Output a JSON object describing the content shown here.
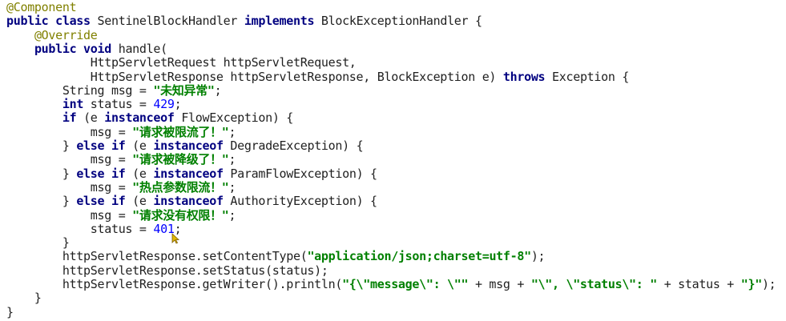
{
  "editor": {
    "colors": {
      "keyword": "#000080",
      "annotation": "#808000",
      "string": "#008000",
      "number": "#0000ff",
      "text": "#1f1f1f",
      "background": "#ffffff"
    },
    "lines": [
      [
        {
          "t": "ann",
          "v": "@Component"
        }
      ],
      [
        {
          "t": "kw",
          "v": "public class "
        },
        {
          "t": "p",
          "v": "SentinelBlockHandler "
        },
        {
          "t": "kw",
          "v": "implements "
        },
        {
          "t": "p",
          "v": "BlockExceptionHandler {"
        }
      ],
      [
        {
          "t": "p",
          "v": "    "
        },
        {
          "t": "ann",
          "v": "@Override"
        }
      ],
      [
        {
          "t": "p",
          "v": "    "
        },
        {
          "t": "kw",
          "v": "public void "
        },
        {
          "t": "p",
          "v": "handle("
        }
      ],
      [
        {
          "t": "p",
          "v": "            HttpServletRequest httpServletRequest,"
        }
      ],
      [
        {
          "t": "p",
          "v": "            HttpServletResponse httpServletResponse, BlockException e) "
        },
        {
          "t": "kw",
          "v": "throws "
        },
        {
          "t": "p",
          "v": "Exception {"
        }
      ],
      [
        {
          "t": "p",
          "v": "        String msg = "
        },
        {
          "t": "str",
          "v": "\"未知异常\""
        },
        {
          "t": "p",
          "v": ";"
        }
      ],
      [
        {
          "t": "p",
          "v": "        "
        },
        {
          "t": "kw",
          "v": "int "
        },
        {
          "t": "p",
          "v": "status = "
        },
        {
          "t": "num",
          "v": "429"
        },
        {
          "t": "p",
          "v": ";"
        }
      ],
      [
        {
          "t": "p",
          "v": "        "
        },
        {
          "t": "kw",
          "v": "if "
        },
        {
          "t": "p",
          "v": "(e "
        },
        {
          "t": "kw",
          "v": "instanceof "
        },
        {
          "t": "p",
          "v": "FlowException) {"
        }
      ],
      [
        {
          "t": "p",
          "v": "            msg = "
        },
        {
          "t": "str",
          "v": "\"请求被限流了！\""
        },
        {
          "t": "p",
          "v": ";"
        }
      ],
      [
        {
          "t": "p",
          "v": "        } "
        },
        {
          "t": "kw",
          "v": "else if "
        },
        {
          "t": "p",
          "v": "(e "
        },
        {
          "t": "kw",
          "v": "instanceof "
        },
        {
          "t": "p",
          "v": "DegradeException) {"
        }
      ],
      [
        {
          "t": "p",
          "v": "            msg = "
        },
        {
          "t": "str",
          "v": "\"请求被降级了！\""
        },
        {
          "t": "p",
          "v": ";"
        }
      ],
      [
        {
          "t": "p",
          "v": "        } "
        },
        {
          "t": "kw",
          "v": "else if "
        },
        {
          "t": "p",
          "v": "(e "
        },
        {
          "t": "kw",
          "v": "instanceof "
        },
        {
          "t": "p",
          "v": "ParamFlowException) {"
        }
      ],
      [
        {
          "t": "p",
          "v": "            msg = "
        },
        {
          "t": "str",
          "v": "\"热点参数限流！\""
        },
        {
          "t": "p",
          "v": ";"
        }
      ],
      [
        {
          "t": "p",
          "v": "        } "
        },
        {
          "t": "kw",
          "v": "else if "
        },
        {
          "t": "p",
          "v": "(e "
        },
        {
          "t": "kw",
          "v": "instanceof "
        },
        {
          "t": "p",
          "v": "AuthorityException) {"
        }
      ],
      [
        {
          "t": "p",
          "v": "            msg = "
        },
        {
          "t": "str",
          "v": "\"请求没有权限！\""
        },
        {
          "t": "p",
          "v": ";"
        }
      ],
      [
        {
          "t": "p",
          "v": "            status = "
        },
        {
          "t": "num",
          "v": "401"
        },
        {
          "t": "p",
          "v": ";"
        }
      ],
      [
        {
          "t": "p",
          "v": "        }"
        }
      ],
      [
        {
          "t": "p",
          "v": "        httpServletResponse.setContentType("
        },
        {
          "t": "str",
          "v": "\"application/json;charset=utf-8\""
        },
        {
          "t": "p",
          "v": ");"
        }
      ],
      [
        {
          "t": "p",
          "v": "        httpServletResponse.setStatus(status);"
        }
      ],
      [
        {
          "t": "p",
          "v": "        httpServletResponse.getWriter().println("
        },
        {
          "t": "str",
          "v": "\"{\\\"message\\\": \\\"\""
        },
        {
          "t": "p",
          "v": " + msg + "
        },
        {
          "t": "str",
          "v": "\"\\\", \\\"status\\\": \""
        },
        {
          "t": "p",
          "v": " + status + "
        },
        {
          "t": "str",
          "v": "\"}\""
        },
        {
          "t": "p",
          "v": ");"
        }
      ],
      [
        {
          "t": "p",
          "v": "    }"
        }
      ],
      [
        {
          "t": "p",
          "v": "}"
        }
      ]
    ]
  }
}
